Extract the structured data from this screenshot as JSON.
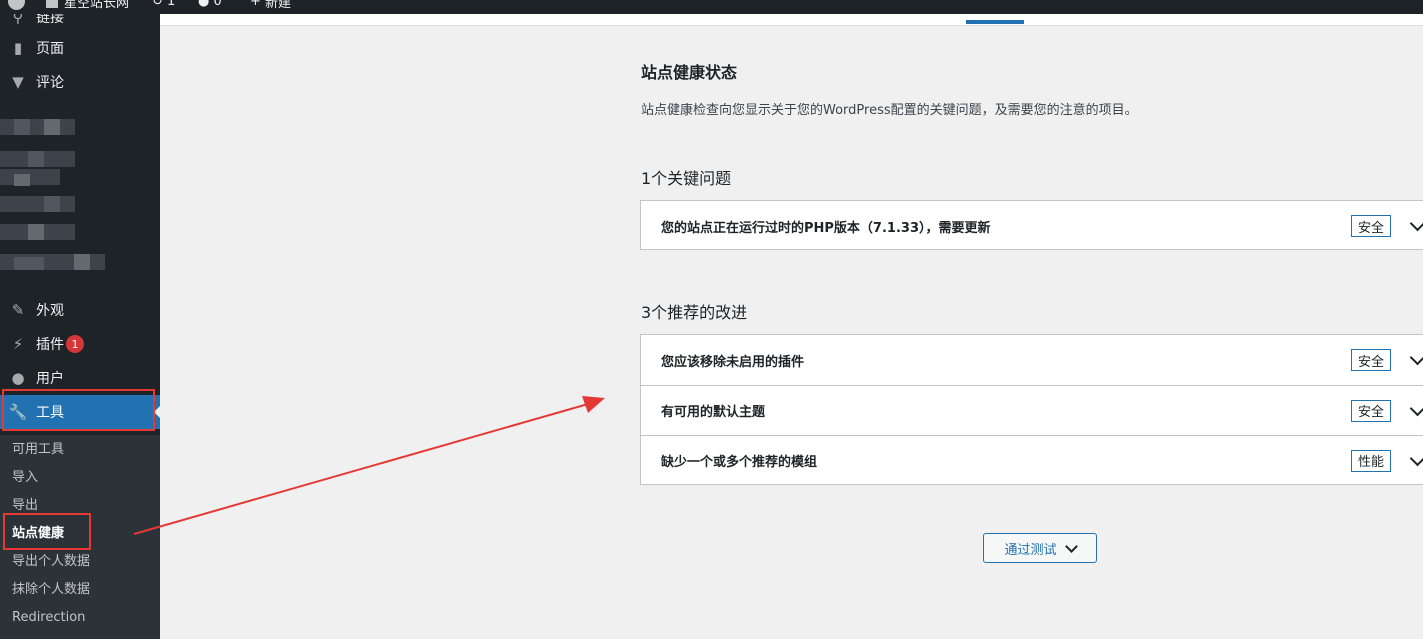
{
  "adminbar": {
    "site_name": "星空站长网",
    "updates_count": "1",
    "comments_count": "0",
    "new_label": "新建"
  },
  "sidebar": {
    "items": [
      {
        "label": "链接",
        "icon": "link-icon"
      },
      {
        "label": "页面",
        "icon": "page-icon"
      },
      {
        "label": "评论",
        "icon": "comment-icon"
      },
      {
        "label": "外观",
        "icon": "appearance-icon"
      },
      {
        "label": "插件",
        "icon": "plugins-icon",
        "badge": "1"
      },
      {
        "label": "用户",
        "icon": "users-icon"
      },
      {
        "label": "工具",
        "icon": "tools-icon",
        "active": true
      }
    ],
    "submenu": [
      {
        "label": "可用工具"
      },
      {
        "label": "导入"
      },
      {
        "label": "导出"
      },
      {
        "label": "站点健康",
        "current": true
      },
      {
        "label": "导出个人数据"
      },
      {
        "label": "抹除个人数据"
      },
      {
        "label": "Redirection"
      }
    ]
  },
  "main": {
    "title": "站点健康状态",
    "description": "站点健康检查向您显示关于您的WordPress配置的关键问题，及需要您的注意的项目。",
    "critical_heading": "1个关键问题",
    "critical_items": [
      {
        "title": "您的站点正在运行过时的PHP版本（7.1.33），需要更新",
        "badge": "安全"
      }
    ],
    "recommended_heading": "3个推荐的改进",
    "recommended_items": [
      {
        "title": "您应该移除未启用的插件",
        "badge": "安全"
      },
      {
        "title": "有可用的默认主题",
        "badge": "安全"
      },
      {
        "title": "缺少一个或多个推荐的模组",
        "badge": "性能"
      }
    ],
    "passed_button": "通过测试"
  },
  "colors": {
    "sidebar_bg": "#1d2327",
    "accent": "#2271b1",
    "annotation_red": "#e53935",
    "badge_red": "#d63638"
  }
}
